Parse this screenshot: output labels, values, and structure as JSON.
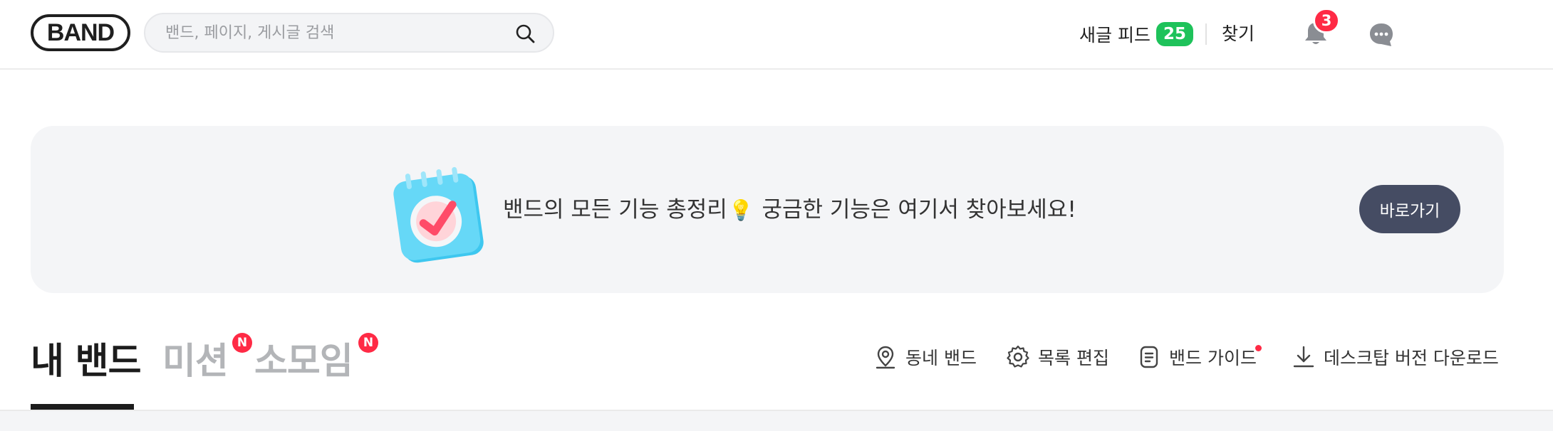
{
  "header": {
    "logo_text": "BAND",
    "search": {
      "placeholder": "밴드, 페이지, 게시글 검색"
    },
    "new_feed": {
      "label": "새글 피드",
      "count": "25"
    },
    "find_label": "찾기",
    "notification_count": "3"
  },
  "banner": {
    "text_before": "밴드의 모든 기능 총정리",
    "text_after": " 궁금한 기능은 여기서 찾아보세요!",
    "button_label": "바로가기"
  },
  "tabs": [
    {
      "label": "내 밴드",
      "active": true,
      "badge": ""
    },
    {
      "label": "미션",
      "active": false,
      "badge": "N"
    },
    {
      "label": "소모임",
      "active": false,
      "badge": "N"
    }
  ],
  "tools": [
    {
      "label": "동네 밴드",
      "icon": "location-pin-icon"
    },
    {
      "label": "목록 편집",
      "icon": "gear-icon"
    },
    {
      "label": "밴드 가이드",
      "icon": "document-icon"
    },
    {
      "label": "데스크탑 버전 다운로드",
      "icon": "download-icon"
    }
  ],
  "colors": {
    "accent_green": "#1ec25a",
    "alert_red": "#ff2a45",
    "button_dark": "#454c63",
    "banner_bg": "#f4f5f7"
  }
}
